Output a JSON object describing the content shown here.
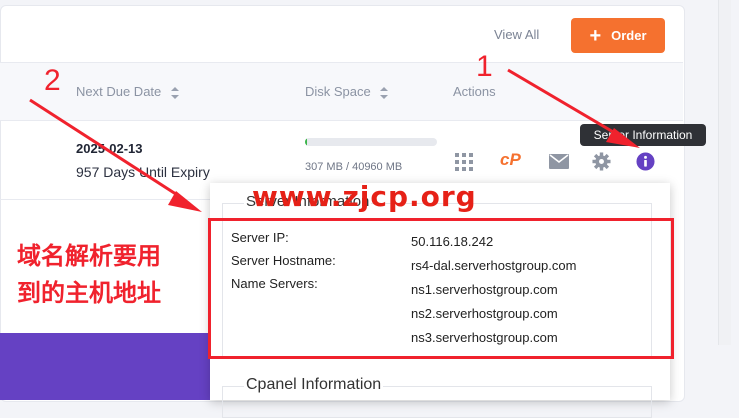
{
  "header": {
    "view_all": "View All",
    "order_label": "Order"
  },
  "table": {
    "columns": [
      "Next Due Date",
      "Disk Space",
      "Actions"
    ],
    "row": {
      "due_date": "2025-02-13",
      "expiry_text": "957 Days Until Expiry",
      "disk_text": "307 MB / 40960 MB",
      "disk_fraction": 0.0075
    }
  },
  "actions": {
    "icons": [
      "grid-icon",
      "cpanel-icon",
      "mail-icon",
      "gear-icon",
      "info-icon"
    ],
    "cpanel_text": "cP",
    "tooltip": "Server Information"
  },
  "popup": {
    "server_legend": "Server Information",
    "fields": [
      {
        "label": "Server IP:",
        "value": "50.116.18.242"
      },
      {
        "label": "Server Hostname:",
        "value": "rs4-dal.serverhostgroup.com"
      },
      {
        "label": "Name Servers:",
        "value": "ns1.serverhostgroup.com"
      }
    ],
    "extra_values": [
      "ns2.serverhostgroup.com",
      "ns3.serverhostgroup.com"
    ],
    "cpanel_legend": "Cpanel Information"
  },
  "annotations": {
    "watermark": "www.zjcp.org",
    "note_line1": "域名解析要用",
    "note_line2": "到的主机地址",
    "marker1": "1",
    "marker2": "2"
  },
  "colors": {
    "accent_orange": "#f5712f",
    "disk_fill": "#3bb54a",
    "info_purple": "#6541c3",
    "annotation_red": "#f0222d"
  }
}
